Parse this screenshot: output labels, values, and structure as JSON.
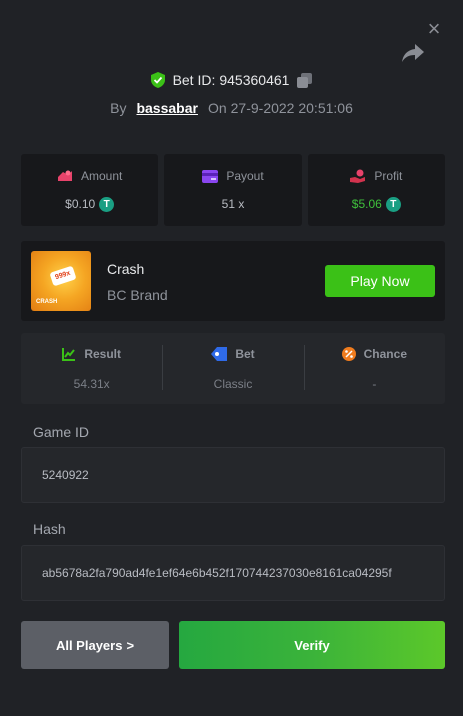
{
  "header": {
    "bet_id_label": "Bet ID:",
    "bet_id": "945360461",
    "by_label": "By",
    "username": "bassabar",
    "on_label": "On",
    "datetime": "27-9-2022 20:51:06"
  },
  "stats": [
    {
      "label": "Amount",
      "value": "$0.10",
      "currency_icon": "T",
      "color": "#b9bcc3"
    },
    {
      "label": "Payout",
      "value": "51 x",
      "currency_icon": "",
      "color": "#b9bcc3"
    },
    {
      "label": "Profit",
      "value": "$5.06",
      "currency_icon": "T",
      "color": "#3fc13c"
    }
  ],
  "game": {
    "name": "Crash",
    "brand": "BC Brand",
    "thumb_tag": "999x",
    "thumb_label": "CRASH",
    "play_label": "Play Now"
  },
  "details": [
    {
      "label": "Result",
      "value": "54.31x"
    },
    {
      "label": "Bet",
      "value": "Classic"
    },
    {
      "label": "Chance",
      "value": "-"
    }
  ],
  "game_id": {
    "label": "Game ID",
    "value": "5240922"
  },
  "hash": {
    "label": "Hash",
    "value": "ab5678a2fa790ad4fe1ef64e6b452f170744237030e8161ca04295f"
  },
  "buttons": {
    "all_players": "All Players",
    "all_players_chevron": ">",
    "verify": "Verify"
  },
  "colors": {
    "accent_green": "#3bc117",
    "profit_green": "#3fc13c",
    "usdt": "#1a9f83",
    "background": "#202226"
  }
}
